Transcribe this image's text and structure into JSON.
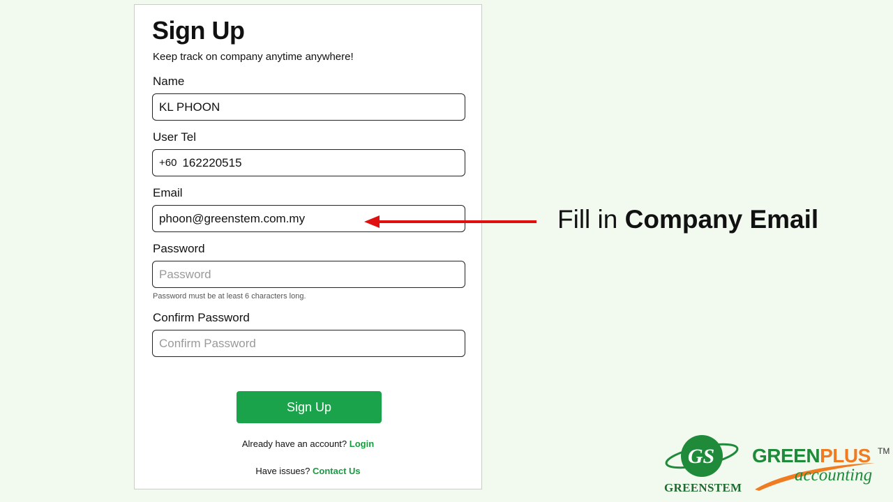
{
  "form": {
    "title": "Sign Up",
    "subtitle": "Keep track on company anytime anywhere!",
    "name": {
      "label": "Name",
      "value": "KL PHOON"
    },
    "tel": {
      "label": "User Tel",
      "prefix": "+60",
      "value": "162220515"
    },
    "email": {
      "label": "Email",
      "value": "phoon@greenstem.com.my"
    },
    "password": {
      "label": "Password",
      "placeholder": "Password",
      "hint": "Password must be at least 6 characters long."
    },
    "confirm": {
      "label": "Confirm Password",
      "placeholder": "Confirm Password"
    },
    "submit_label": "Sign Up",
    "login_prompt": "Already have an account?",
    "login_link": "Login",
    "issues_prompt": "Have issues?",
    "contact_link": "Contact Us"
  },
  "annotation": {
    "prefix": "Fill in",
    "emphasis": "Company Email",
    "arrow_color": "#e01010"
  },
  "branding": {
    "greenstem_word": "GREENSTEM",
    "greenstem_monogram": "GS",
    "greenplus_part1": "GREEN",
    "greenplus_part2": "PLUS",
    "greenplus_tm": "TM",
    "greenplus_sub": "accounting",
    "green": "#1f8a3a",
    "orange": "#f07c22"
  },
  "colors": {
    "background": "#f2f9ef",
    "accent": "#1aa34a"
  }
}
